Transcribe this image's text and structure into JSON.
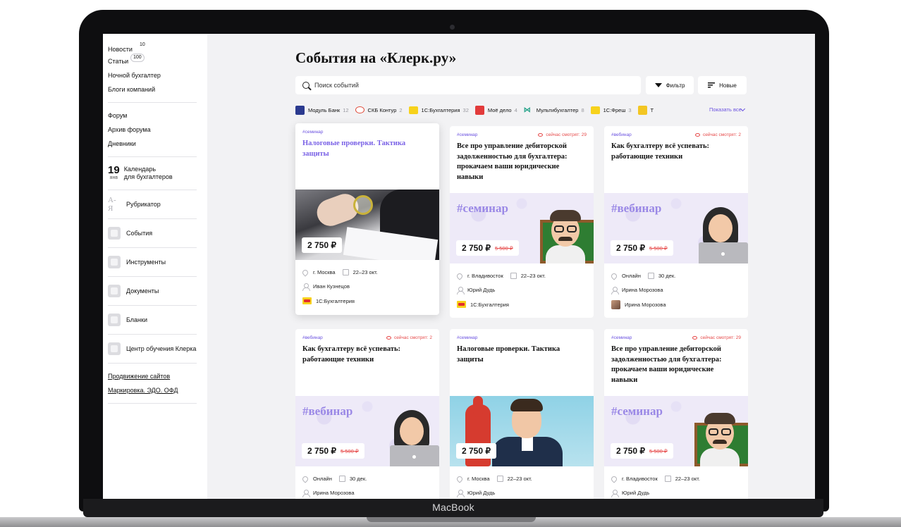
{
  "device": {
    "label": "MacBook"
  },
  "colors": {
    "accent": "#6b52e0",
    "watching": "#e64a4a",
    "background": "#f2f2f4"
  },
  "sidebar": {
    "group1": [
      {
        "label": "Новости",
        "count": "10"
      },
      {
        "label": "Статьи",
        "count": "100"
      },
      {
        "label": "Ночной бухгалтер"
      },
      {
        "label": "Блоги компаний"
      }
    ],
    "group2": [
      {
        "label": "Форум"
      },
      {
        "label": "Архив форума"
      },
      {
        "label": "Дневники"
      }
    ],
    "calendar": {
      "day": "19",
      "month": "янв",
      "line1": "Календарь",
      "line2": "для бухгалтеров"
    },
    "rubricator": {
      "icon_text": "А-Я",
      "label": "Рубрикатор"
    },
    "tools": [
      {
        "label": "События",
        "icon": "events-icon"
      },
      {
        "label": "Инструменты",
        "icon": "tools-icon"
      },
      {
        "label": "Документы",
        "icon": "documents-icon"
      },
      {
        "label": "Бланки",
        "icon": "forms-icon"
      },
      {
        "label": "Центр обучения Клерка",
        "icon": "education-icon"
      }
    ],
    "links": [
      {
        "label": "Продвижение сайтов"
      },
      {
        "label": "Маркировка. ЭДО. ОФД"
      }
    ]
  },
  "header": {
    "title": "События на «Клерк.ру»",
    "search_placeholder": "Поиск событий",
    "filter_label": "Фильтр",
    "sort_label": "Новые"
  },
  "companies": [
    {
      "name": "Модуль Банк",
      "count": "12",
      "color": "#2b3a8f"
    },
    {
      "name": "СКБ Контур",
      "count": "2",
      "color": "#e04a3a"
    },
    {
      "name": "1С:Бухгалтерия",
      "count": "32",
      "color": "#f7d21c"
    },
    {
      "name": "Моё дело",
      "count": "4",
      "color": "#e23b3b"
    },
    {
      "name": "Мультибухгалтер",
      "count": "8",
      "color": "#2ca58d"
    },
    {
      "name": "1С:Фреш",
      "count": "3",
      "color": "#f7d21c"
    },
    {
      "name": "Т",
      "count": "",
      "color": "#f3c623"
    }
  ],
  "show_all": "Показать все",
  "cards": [
    {
      "tag": "#семинар",
      "watching": "",
      "title": "Налоговые проверки. Тактика защиты",
      "image": "desk",
      "image_word": "",
      "price": "2 750 ₽",
      "old_price": "",
      "city": "г. Москва",
      "date": "22–23 окт.",
      "speaker": "Иван Кузнецов",
      "org": "1С:Бухгалтерия",
      "org_logo": "1c-logo"
    },
    {
      "tag": "#семинар",
      "watching": "сейчас смотрят: 29",
      "title": "Все про управление дебиторской задолженностью для бухгалтера: прокачаем ваши юридические навыки",
      "image": "teacher",
      "image_word": "#семинар",
      "price": "2 750 ₽",
      "old_price": "5 500 ₽",
      "city": "г. Владивосток",
      "date": "22–23 окт.",
      "speaker": "Юрий Дудь",
      "org": "1С:Бухгалтерия",
      "org_logo": "1c-logo"
    },
    {
      "tag": "#вебинар",
      "watching": "сейчас смотрят: 2",
      "title": "Как бухгалтеру всё успевать: работающие техники",
      "image": "woman",
      "image_word": "#вебинар",
      "price": "2 750 ₽",
      "old_price": "5 500 ₽",
      "city": "Онлайн",
      "date": "30 дек.",
      "speaker": "Ирина Морозова",
      "org": "Ирина Морозова",
      "org_logo": "photo"
    },
    {
      "tag": "#вебинар",
      "watching": "сейчас смотрят: 2",
      "title": "Как бухгалтеру всё успевать: работающие техники",
      "image": "woman",
      "image_word": "#вебинар",
      "price": "2 750 ₽",
      "old_price": "5 500 ₽",
      "city": "Онлайн",
      "date": "30 дек.",
      "speaker": "Ирина Морозова",
      "org": "",
      "org_logo": ""
    },
    {
      "tag": "#семинар",
      "watching": "",
      "title": "Налоговые проверки. Тактика защиты",
      "image": "studio",
      "image_word": "",
      "price": "2 750 ₽",
      "old_price": "",
      "city": "г. Москва",
      "date": "22–23 окт.",
      "speaker": "Юрий Дудь",
      "org": "",
      "org_logo": ""
    },
    {
      "tag": "#семинар",
      "watching": "сейчас смотрят: 29",
      "title": "Все про управление дебиторской задолженностью для бухгалтера: прокачаем ваши юридические навыки",
      "image": "teacher",
      "image_word": "#семинар",
      "price": "2 750 ₽",
      "old_price": "5 500 ₽",
      "city": "г. Владивосток",
      "date": "22–23 окт.",
      "speaker": "Юрий Дудь",
      "org": "",
      "org_logo": ""
    }
  ]
}
